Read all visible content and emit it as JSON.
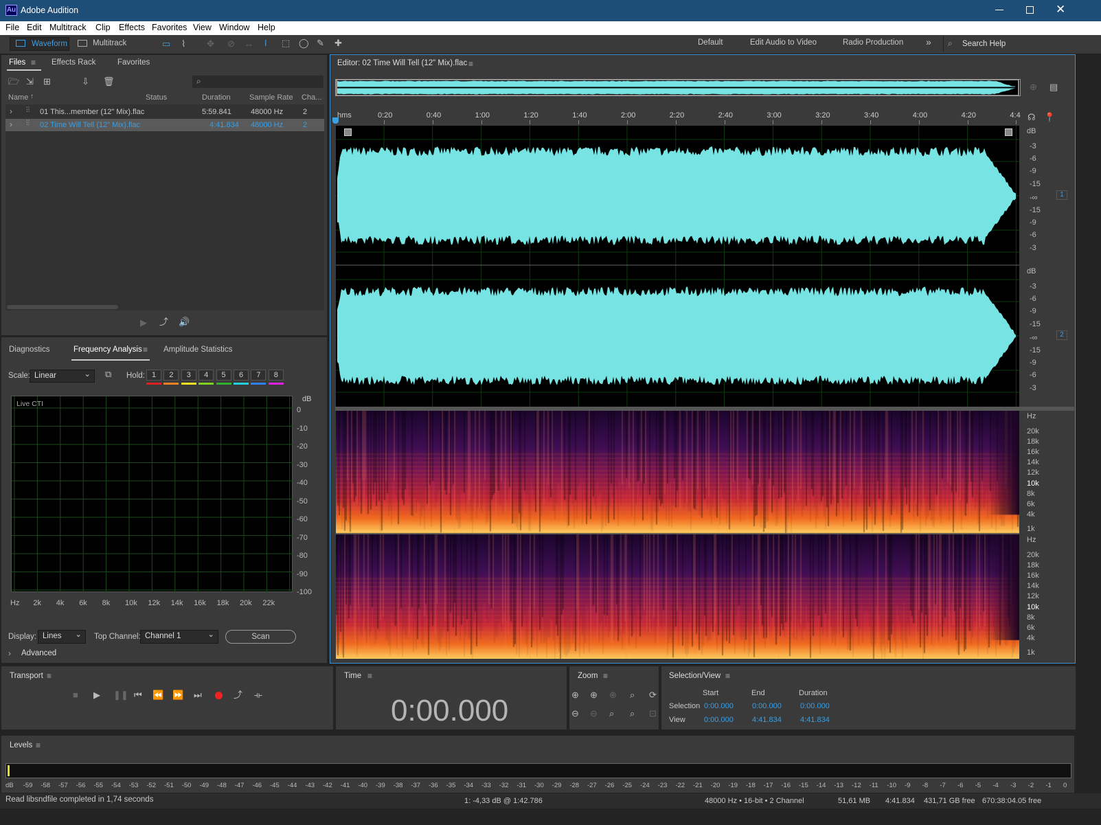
{
  "app": {
    "icon_text": "Au",
    "title": "Adobe Audition"
  },
  "menu": [
    "File",
    "Edit",
    "Multitrack",
    "Clip",
    "Effects",
    "Favorites",
    "View",
    "Window",
    "Help"
  ],
  "toolbar": {
    "waveform_label": "Waveform",
    "multitrack_label": "Multitrack",
    "workspaces": [
      "Default",
      "Edit Audio to Video",
      "Radio Production"
    ],
    "more": "»",
    "search_placeholder": "Search Help"
  },
  "files_panel": {
    "tabs": [
      "Files",
      "Effects Rack",
      "Favorites"
    ],
    "columns": [
      "Name",
      "Status",
      "Duration",
      "Sample Rate",
      "Cha..."
    ],
    "rows": [
      {
        "name": "01 This...member (12\" Mix).flac",
        "status": "",
        "duration": "5:59.841",
        "rate": "48000 Hz",
        "channels": "2"
      },
      {
        "name": "02 Time Will Tell (12\" Mix).flac",
        "status": "",
        "duration": "4:41.834",
        "rate": "48000 Hz",
        "channels": "2"
      }
    ]
  },
  "analysis_panel": {
    "tabs": [
      "Diagnostics",
      "Frequency Analysis",
      "Amplitude Statistics"
    ],
    "scale_label": "Scale:",
    "scale_value": "Linear",
    "hold_label": "Hold:",
    "hold_buttons": [
      "1",
      "2",
      "3",
      "4",
      "5",
      "6",
      "7",
      "8"
    ],
    "hold_colors": [
      "#e02020",
      "#f08020",
      "#f0e020",
      "#80d020",
      "#30b030",
      "#20d0e0",
      "#3080f0",
      "#e020e0"
    ],
    "graph_label": "Live CTI",
    "db_unit": "dB",
    "db_ticks": [
      "0",
      "-10",
      "-20",
      "-30",
      "-40",
      "-50",
      "-60",
      "-70",
      "-80",
      "-90",
      "-100"
    ],
    "hz_ticks": [
      "Hz",
      "2k",
      "4k",
      "6k",
      "8k",
      "10k",
      "12k",
      "14k",
      "16k",
      "18k",
      "20k",
      "22k"
    ],
    "display_label": "Display:",
    "display_value": "Lines",
    "top_channel_label": "Top Channel:",
    "top_channel_value": "Channel 1",
    "scan_button": "Scan",
    "advanced_label": "Advanced"
  },
  "editor": {
    "title": "Editor: 02 Time Will Tell (12\" Mix).flac",
    "ruler_unit": "hms",
    "ruler_ticks": [
      "0:20",
      "0:40",
      "1:00",
      "1:20",
      "1:40",
      "2:00",
      "2:20",
      "2:40",
      "3:00",
      "3:20",
      "3:40",
      "4:00",
      "4:20",
      "4:4"
    ],
    "db_unit": "dB",
    "db_scale": [
      "-3",
      "-6",
      "-9",
      "-15",
      "-∞",
      "-15",
      "-9",
      "-6",
      "-3"
    ],
    "channel_labels": [
      "1",
      "2"
    ],
    "hz_unit": "Hz",
    "hz_scale": [
      "20k",
      "18k",
      "16k",
      "14k",
      "12k",
      "10k",
      "8k",
      "6k",
      "4k",
      "1k"
    ],
    "waveform_color": "#77e3e3"
  },
  "transport": {
    "title": "Transport"
  },
  "time": {
    "title": "Time",
    "value": "0:00.000"
  },
  "zoom": {
    "title": "Zoom"
  },
  "selection": {
    "title": "Selection/View",
    "headers": [
      "Start",
      "End",
      "Duration"
    ],
    "rows": [
      {
        "label": "Selection",
        "start": "0:00.000",
        "end": "0:00.000",
        "duration": "0:00.000"
      },
      {
        "label": "View",
        "start": "0:00.000",
        "end": "4:41.834",
        "duration": "4:41.834"
      }
    ]
  },
  "levels": {
    "title": "Levels",
    "ticks": [
      "dB",
      "-59",
      "-58",
      "-57",
      "-56",
      "-55",
      "-54",
      "-53",
      "-52",
      "-51",
      "-50",
      "-49",
      "-48",
      "-47",
      "-46",
      "-45",
      "-44",
      "-43",
      "-42",
      "-41",
      "-40",
      "-39",
      "-38",
      "-37",
      "-36",
      "-35",
      "-34",
      "-33",
      "-32",
      "-31",
      "-30",
      "-29",
      "-28",
      "-27",
      "-26",
      "-25",
      "-24",
      "-23",
      "-22",
      "-21",
      "-20",
      "-19",
      "-18",
      "-17",
      "-16",
      "-15",
      "-14",
      "-13",
      "-12",
      "-11",
      "-10",
      "-9",
      "-8",
      "-7",
      "-6",
      "-5",
      "-4",
      "-3",
      "-2",
      "-1",
      "0"
    ]
  },
  "statusbar": {
    "message": "Read libsndfile completed in 1,74 seconds",
    "cursor": "1: -4,33 dB @ 1:42.786",
    "format": "48000 Hz • 16-bit • 2 Channel",
    "size": "51,61 MB",
    "duration": "4:41.834",
    "disk_free": "431,71 GB free",
    "time_free": "670:38:04.05 free"
  }
}
